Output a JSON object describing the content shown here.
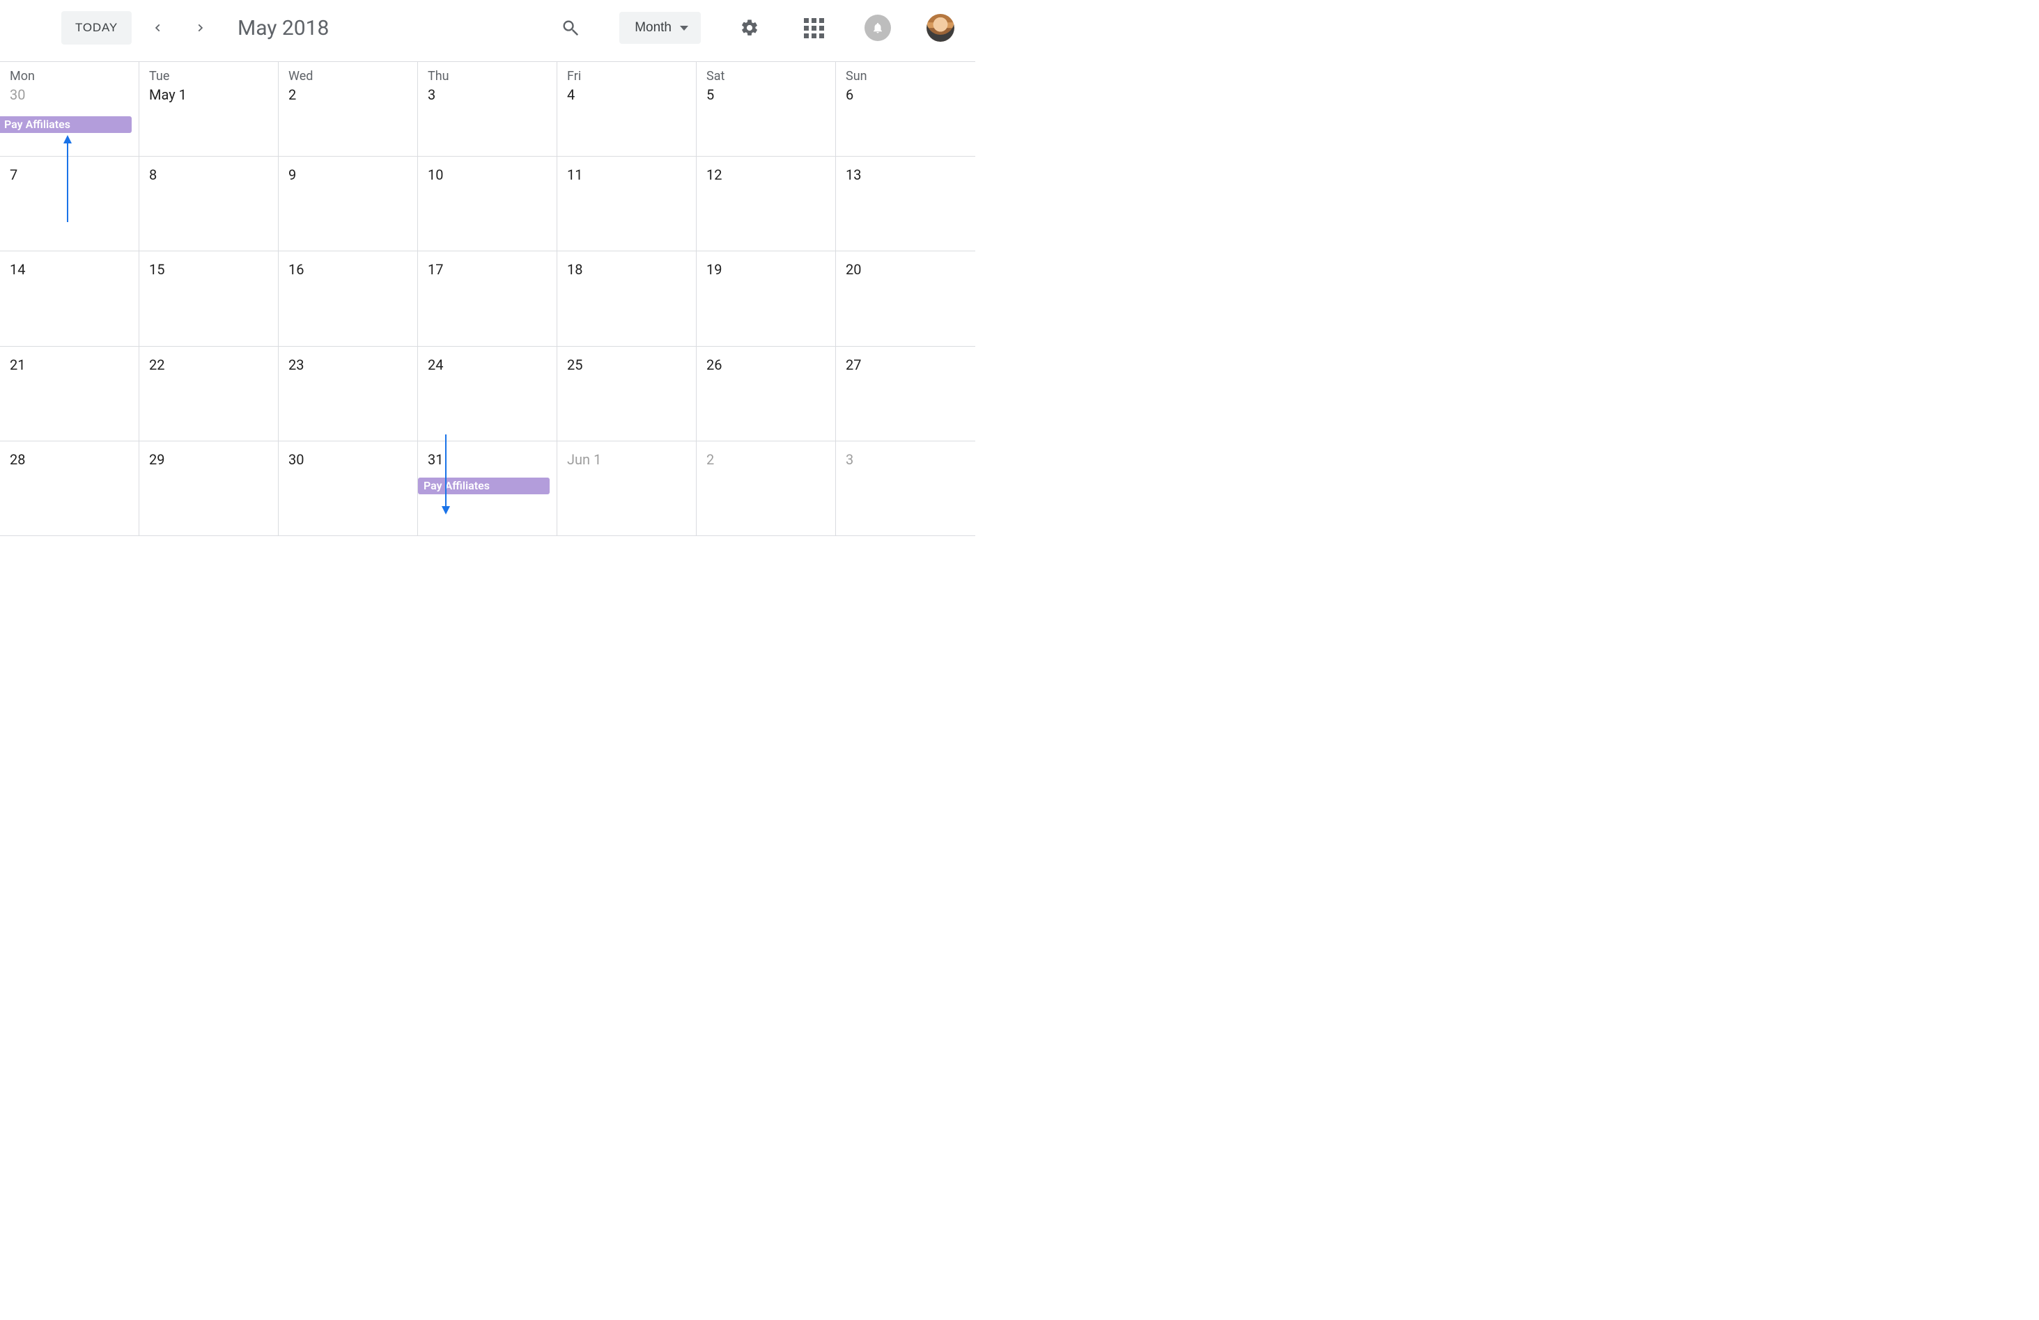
{
  "header": {
    "today_label": "TODAY",
    "current_date": "May 2018",
    "view_label": "Month"
  },
  "icons": {
    "search": "search-icon",
    "settings": "gear-icon",
    "apps": "apps-grid-icon",
    "notifications": "bell-icon"
  },
  "colors": {
    "event_purple": "#b39ddb",
    "arrow_blue": "#1a73e8"
  },
  "dow": [
    "Mon",
    "Tue",
    "Wed",
    "Thu",
    "Fri",
    "Sat",
    "Sun"
  ],
  "weeks": [
    [
      {
        "date": "30",
        "muted": true,
        "label": "30",
        "event": "Pay Affiliates"
      },
      {
        "date": "May 1",
        "label": "May 1"
      },
      {
        "date": "2",
        "label": "2"
      },
      {
        "date": "3",
        "label": "3"
      },
      {
        "date": "4",
        "label": "4"
      },
      {
        "date": "5",
        "label": "5"
      },
      {
        "date": "6",
        "label": "6"
      }
    ],
    [
      {
        "date": "7",
        "label": "7"
      },
      {
        "date": "8",
        "label": "8"
      },
      {
        "date": "9",
        "label": "9"
      },
      {
        "date": "10",
        "label": "10"
      },
      {
        "date": "11",
        "label": "11"
      },
      {
        "date": "12",
        "label": "12"
      },
      {
        "date": "13",
        "label": "13"
      }
    ],
    [
      {
        "date": "14",
        "label": "14"
      },
      {
        "date": "15",
        "label": "15"
      },
      {
        "date": "16",
        "label": "16"
      },
      {
        "date": "17",
        "label": "17"
      },
      {
        "date": "18",
        "label": "18"
      },
      {
        "date": "19",
        "label": "19"
      },
      {
        "date": "20",
        "label": "20"
      }
    ],
    [
      {
        "date": "21",
        "label": "21"
      },
      {
        "date": "22",
        "label": "22"
      },
      {
        "date": "23",
        "label": "23"
      },
      {
        "date": "24",
        "label": "24"
      },
      {
        "date": "25",
        "label": "25"
      },
      {
        "date": "26",
        "label": "26"
      },
      {
        "date": "27",
        "label": "27"
      }
    ],
    [
      {
        "date": "28",
        "label": "28"
      },
      {
        "date": "29",
        "label": "29"
      },
      {
        "date": "30",
        "label": "30"
      },
      {
        "date": "31",
        "label": "31",
        "event": "Pay Affiliates"
      },
      {
        "date": "Jun 1",
        "muted": true,
        "label": "Jun 1"
      },
      {
        "date": "2",
        "muted": true,
        "label": "2"
      },
      {
        "date": "3",
        "muted": true,
        "label": "3"
      }
    ]
  ]
}
